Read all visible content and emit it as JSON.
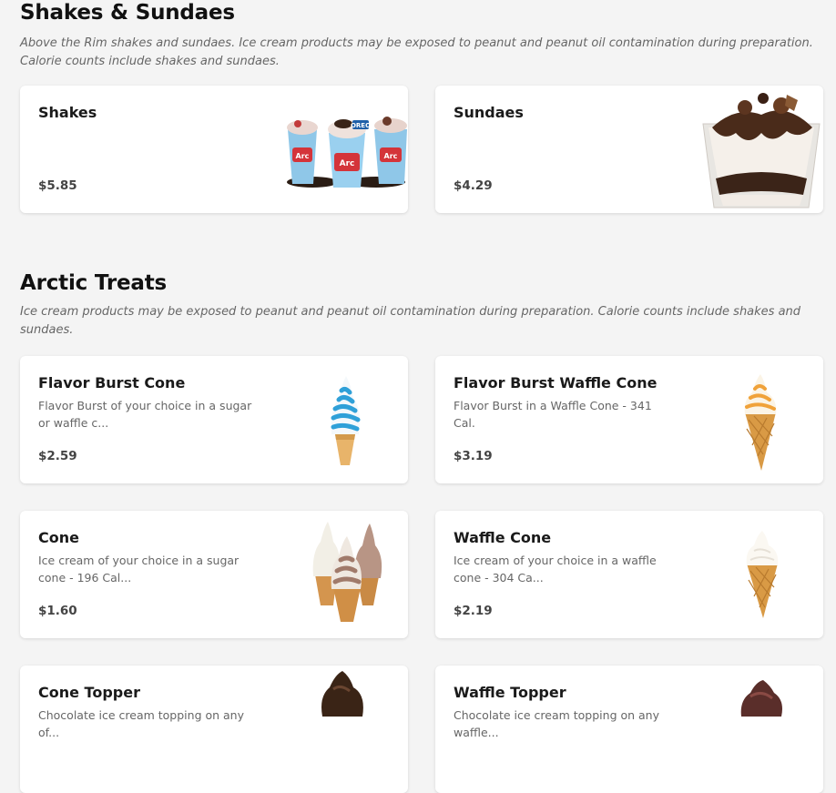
{
  "sections": [
    {
      "title": "Shakes & Sundaes",
      "description": "Above the Rim shakes and sundaes. Ice cream products may be exposed to peanut and peanut oil contamination during preparation. Calorie counts include shakes and sundaes.",
      "items": [
        {
          "name": "Shakes",
          "description": "",
          "price": "$5.85",
          "image": "shakes-photo"
        },
        {
          "name": "Sundaes",
          "description": "",
          "price": "$4.29",
          "image": "sundae-photo"
        }
      ]
    },
    {
      "title": "Arctic Treats",
      "description": "Ice cream products may be exposed to peanut and peanut oil contamination during preparation. Calorie counts include shakes and sundaes.",
      "items": [
        {
          "name": "Flavor Burst Cone",
          "description": "Flavor Burst of your choice in a sugar or waffle c...",
          "price": "$2.59",
          "image": "flavor-burst-cone-photo"
        },
        {
          "name": "Flavor Burst Waffle Cone",
          "description": "Flavor Burst in a Waffle Cone - 341 Cal.",
          "price": "$3.19",
          "image": "flavor-burst-waffle-cone-photo"
        },
        {
          "name": "Cone",
          "description": "Ice cream of your choice in a sugar cone - 196 Cal...",
          "price": "$1.60",
          "image": "cone-photo"
        },
        {
          "name": "Waffle Cone",
          "description": "Ice cream of your choice in a waffle cone - 304 Ca...",
          "price": "$2.19",
          "image": "waffle-cone-photo"
        },
        {
          "name": "Cone Topper",
          "description": "Chocolate ice cream topping on any of...",
          "price": "",
          "image": "cone-topper-photo"
        },
        {
          "name": "Waffle Topper",
          "description": "Chocolate ice cream topping on any waffle...",
          "price": "",
          "image": "waffle-topper-photo"
        }
      ]
    }
  ],
  "colors": {
    "background": "#f4f4f4",
    "card": "#ffffff",
    "title": "#111111",
    "description": "#666666",
    "price": "#444444"
  }
}
